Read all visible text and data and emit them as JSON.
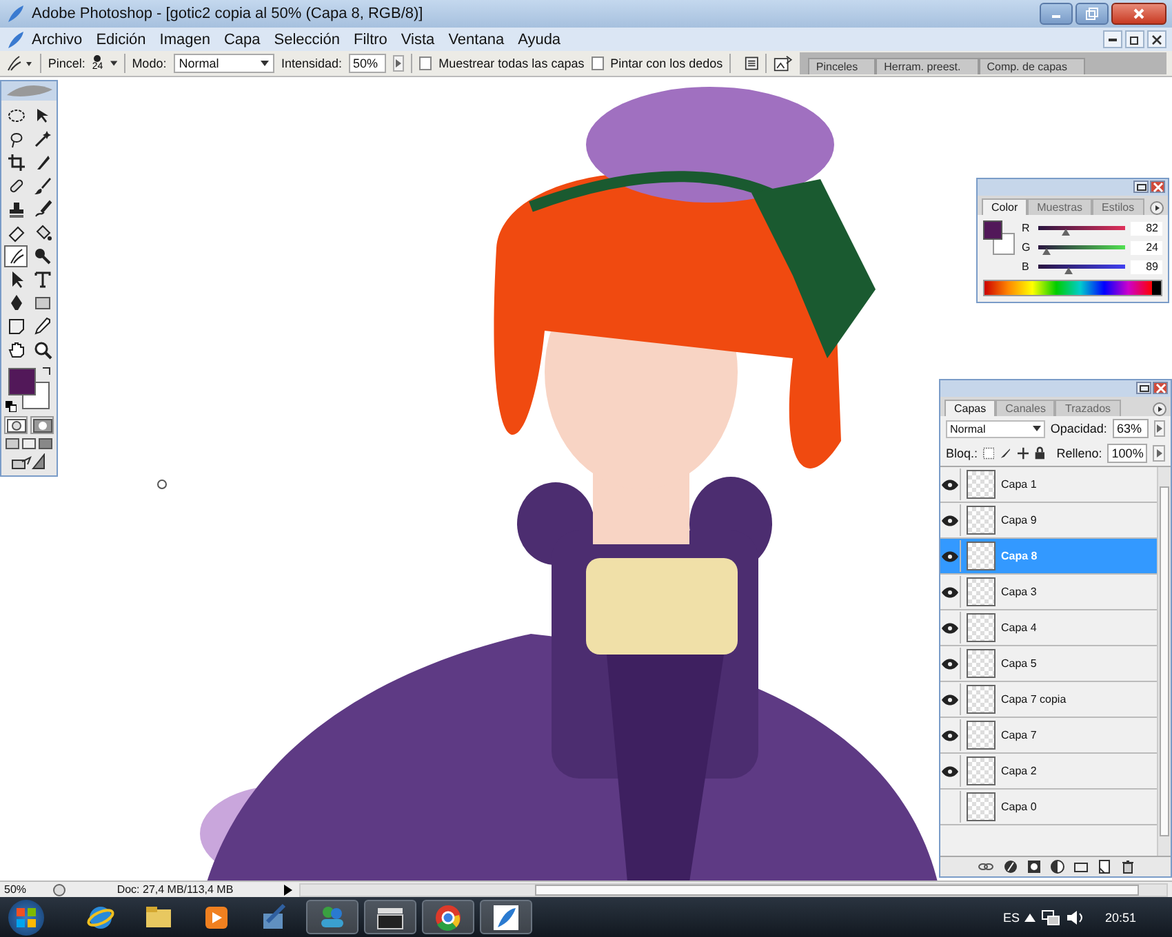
{
  "window": {
    "title": "Adobe Photoshop - [gotic2 copia al 50% (Capa 8, RGB/8)]"
  },
  "menu": [
    "Archivo",
    "Edición",
    "Imagen",
    "Capa",
    "Selección",
    "Filtro",
    "Vista",
    "Ventana",
    "Ayuda"
  ],
  "options_bar": {
    "brush_label": "Pincel:",
    "brush_size": "24",
    "mode_label": "Modo:",
    "mode": "Normal",
    "intensity_label": "Intensidad:",
    "intensity": "50%",
    "checkboxes": [
      {
        "label": "Muestrear todas las capas",
        "checked": false
      },
      {
        "label": "Pintar con los dedos",
        "checked": false
      }
    ],
    "palette_tabs": [
      "Pinceles",
      "Herram. preest.",
      "Comp. de capas"
    ]
  },
  "toolbox": {
    "tools": [
      {
        "kind": "marquee",
        "selected": false
      },
      {
        "kind": "move",
        "selected": false
      },
      {
        "kind": "lasso",
        "selected": false
      },
      {
        "kind": "wand",
        "selected": false
      },
      {
        "kind": "crop",
        "selected": false
      },
      {
        "kind": "slice",
        "selected": false
      },
      {
        "kind": "heal",
        "selected": false
      },
      {
        "kind": "brush",
        "selected": false
      },
      {
        "kind": "stamp",
        "selected": false
      },
      {
        "kind": "history",
        "selected": false
      },
      {
        "kind": "eraser",
        "selected": false
      },
      {
        "kind": "bucket",
        "selected": false
      },
      {
        "kind": "smudge",
        "selected": true
      },
      {
        "kind": "dodge",
        "selected": false
      },
      {
        "kind": "select",
        "selected": false
      },
      {
        "kind": "type",
        "selected": false
      },
      {
        "kind": "pen",
        "selected": false
      },
      {
        "kind": "shape",
        "selected": false
      },
      {
        "kind": "notes",
        "selected": false
      },
      {
        "kind": "eyedropper",
        "selected": false
      },
      {
        "kind": "hand",
        "selected": false
      },
      {
        "kind": "zoom",
        "selected": false
      }
    ]
  },
  "color_panel": {
    "tabs": [
      {
        "label": "Color",
        "selected": true
      },
      {
        "label": "Muestras",
        "selected": false
      },
      {
        "label": "Estilos",
        "selected": false
      }
    ],
    "channels": [
      {
        "name": "R",
        "value": "82",
        "level": 0.32
      },
      {
        "name": "G",
        "value": "24",
        "level": 0.09
      },
      {
        "name": "B",
        "value": "89",
        "level": 0.35
      }
    ]
  },
  "layers_panel": {
    "tabs": [
      {
        "label": "Capas",
        "selected": true
      },
      {
        "label": "Canales",
        "selected": false
      },
      {
        "label": "Trazados",
        "selected": false
      }
    ],
    "blend_mode": "Normal",
    "opacity_label": "Opacidad:",
    "opacity": "63%",
    "lock_label": "Bloq.:",
    "fill_label": "Relleno:",
    "fill": "100%",
    "layers": [
      {
        "name": "Capa 1",
        "visible": true,
        "selected": false
      },
      {
        "name": "Capa 9",
        "visible": true,
        "selected": false
      },
      {
        "name": "Capa 8",
        "visible": true,
        "selected": true
      },
      {
        "name": "Capa 3",
        "visible": true,
        "selected": false
      },
      {
        "name": "Capa 4",
        "visible": true,
        "selected": false
      },
      {
        "name": "Capa 5",
        "visible": true,
        "selected": false
      },
      {
        "name": "Capa 7 copia",
        "visible": true,
        "selected": false
      },
      {
        "name": "Capa 7",
        "visible": true,
        "selected": false
      },
      {
        "name": "Capa 2",
        "visible": true,
        "selected": false
      },
      {
        "name": "Capa 0",
        "visible": false,
        "selected": false
      }
    ]
  },
  "status_bar": {
    "zoom": "50%",
    "doc_info": "Doc: 27,4 MB/113,4 MB"
  },
  "taskbar": {
    "apps": [
      {
        "kind": "globe",
        "running": false
      },
      {
        "kind": "folder",
        "running": false
      },
      {
        "kind": "media",
        "running": false
      },
      {
        "kind": "setup",
        "running": false
      },
      {
        "kind": "people",
        "running": true
      },
      {
        "kind": "clapper",
        "running": true
      },
      {
        "kind": "ring",
        "running": true
      },
      {
        "kind": "feather",
        "running": true
      }
    ],
    "language": "ES",
    "time": "20:51"
  }
}
